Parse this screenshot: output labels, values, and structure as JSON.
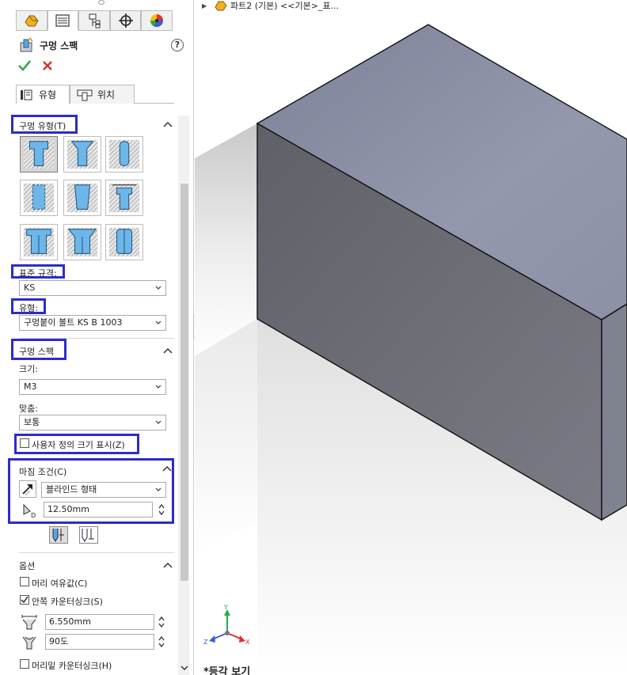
{
  "feature_manager_tabs": [
    "feature-manager-icon",
    "property-manager-icon",
    "configuration-manager-icon",
    "dimxpert-icon",
    "display-manager-icon"
  ],
  "property_manager": {
    "title": "구멍 스팩",
    "help": "?",
    "tabs": [
      {
        "label": "유형",
        "active": true
      },
      {
        "label": "위치",
        "active": false
      }
    ]
  },
  "hole_type": {
    "label": "구멍 유형(T)",
    "types": [
      "counterbore",
      "countersink",
      "hole",
      "straight-tap",
      "tapered-tap",
      "legacy-hole",
      "counterbore-slot",
      "countersink-slot",
      "slot"
    ],
    "selected_index": 0,
    "standard_label": "표준 규격:",
    "standard_value": "KS",
    "type_label": "유형:",
    "type_value": "구멍붙이 볼트 KS B 1003"
  },
  "hole_spec": {
    "label": "구멍 스팩",
    "size_label": "크기:",
    "size_value": "M3",
    "fit_label": "맞춤:",
    "fit_value": "보통",
    "custom_size_label": "사용자 정의 크기 표시(Z)",
    "custom_size_checked": false
  },
  "end_condition": {
    "label": "마침 조건(C)",
    "value": "블라인드 형태",
    "depth": "12.50mm"
  },
  "options": {
    "label": "옵션",
    "head_clearance_label": "머리 여유값(C)",
    "head_clearance_checked": false,
    "near_csink_label": "안쪽 카운터싱크(S)",
    "near_csink_checked": true,
    "near_csink_diameter": "6.550mm",
    "near_csink_angle": "90도",
    "under_head_csink_label": "머리밑 카운터싱크(H)",
    "under_head_csink_checked": false
  },
  "breadcrumb": {
    "text": "파트2 (기본) <<기본>_표..."
  },
  "viewport": {
    "view_label": "*등각 보기",
    "triad": {
      "x": "X",
      "y": "Y",
      "z": "Z"
    },
    "colors": {
      "top_face": "#8a90a8",
      "front_face": "#6c6e78",
      "side_face": "#7a7d8a",
      "edge": "#111111",
      "background": "#ffffff"
    }
  },
  "accent_colors": {
    "highlight_border": "#2c2cc9",
    "ok_green": "#3aa64a",
    "cancel_red": "#d9302b"
  }
}
